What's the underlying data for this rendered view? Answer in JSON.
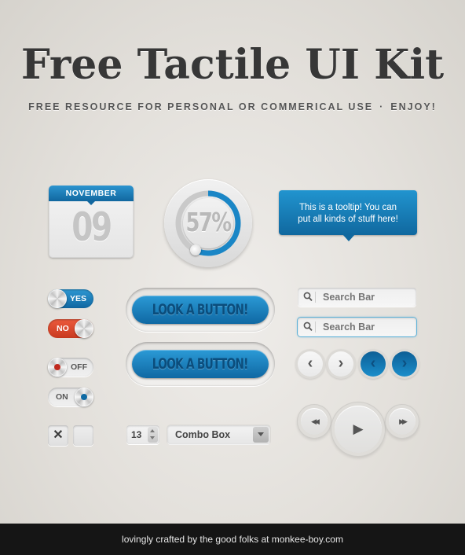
{
  "header": {
    "title": "Free Tactile UI Kit",
    "subtitle_left": "FREE RESOURCE FOR PERSONAL OR COMMERICAL USE",
    "subtitle_separator": "·",
    "subtitle_right": "ENJOY!"
  },
  "calendar": {
    "month": "NOVEMBER",
    "day": "09"
  },
  "progress": {
    "value_percent": 57,
    "label": "57%"
  },
  "tooltip": {
    "text_line1": "This is a tooltip! You can",
    "text_line2": "put all kinds of stuff here!"
  },
  "toggles": [
    {
      "label": "YES",
      "state": "on",
      "color": "#1b7dbd"
    },
    {
      "label": "NO",
      "state": "off",
      "color": "#de4a2d"
    },
    {
      "label": "OFF",
      "state": "off",
      "indicator_color": "#c0291e"
    },
    {
      "label": "ON",
      "state": "on",
      "indicator_color": "#0f6aa3"
    }
  ],
  "checkboxes": [
    {
      "checked": true,
      "glyph": "✕"
    },
    {
      "checked": false,
      "glyph": ""
    }
  ],
  "buttons": [
    {
      "label": "LOOK A BUTTON!"
    },
    {
      "label": "LOOK A BUTTON!"
    }
  ],
  "search": [
    {
      "placeholder": "Search Bar",
      "icon": "search-icon",
      "focused": false
    },
    {
      "placeholder": "Search Bar",
      "icon": "search-icon",
      "focused": true
    }
  ],
  "nav_buttons": [
    {
      "icon": "chevron-left-icon",
      "glyph": "‹",
      "style": "light"
    },
    {
      "icon": "chevron-right-icon",
      "glyph": "›",
      "style": "light"
    },
    {
      "icon": "chevron-left-icon",
      "glyph": "‹",
      "style": "blue"
    },
    {
      "icon": "chevron-right-icon",
      "glyph": "›",
      "style": "blue"
    }
  ],
  "media": {
    "rewind_glyph": "◀◀",
    "play_glyph": "▶",
    "forward_glyph": "▶▶"
  },
  "stepper": {
    "value": "13"
  },
  "combo": {
    "value": "Combo Box"
  },
  "footer": {
    "text": "lovingly crafted by the good folks at monkee-boy.com"
  },
  "colors": {
    "accent_blue": "#1b7dbd",
    "alert_red": "#de4a2d",
    "text_dark": "#373737"
  }
}
